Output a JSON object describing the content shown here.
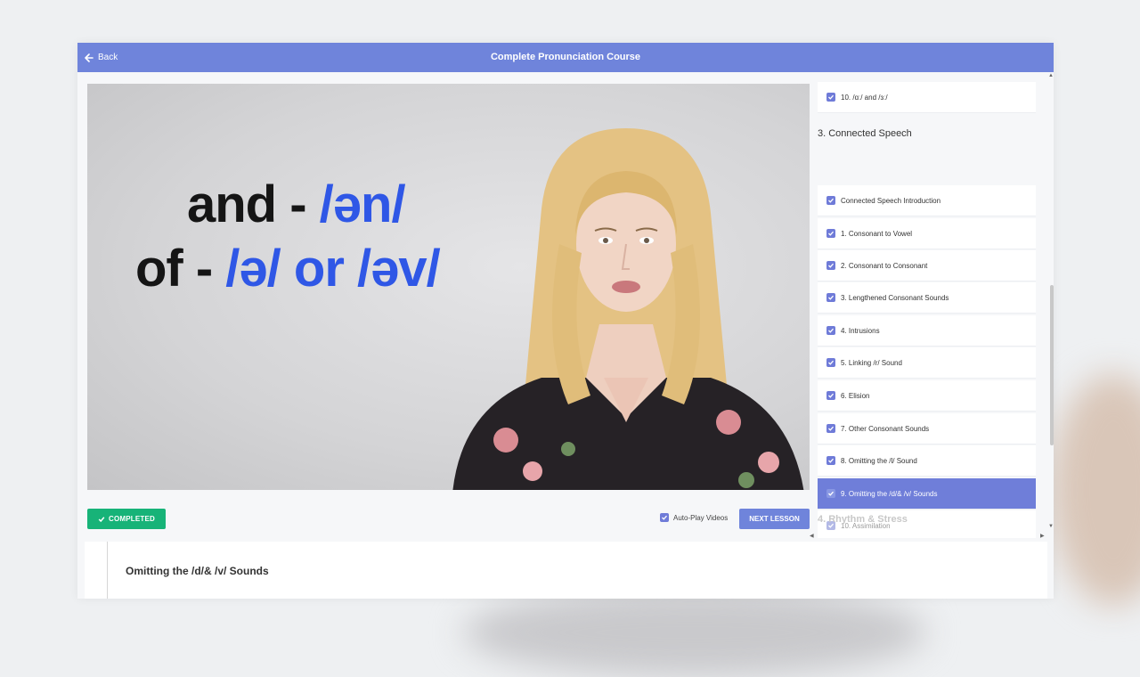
{
  "header": {
    "back_label": "Back",
    "course_title": "Complete Pronunciation Course"
  },
  "video": {
    "caption_lines": [
      {
        "word": "and - ",
        "phonetic": "/ən/"
      },
      {
        "word": "of - ",
        "phonetic": "/ə/ or /əv/"
      }
    ]
  },
  "sections": [
    {
      "title": "3. Connected Speech"
    },
    {
      "title": "4. Rhythm & Stress"
    }
  ],
  "lessons": [
    {
      "label": "10. /ɑː/ and /ɜː/",
      "state": "done"
    },
    {
      "label": "Connected Speech Introduction",
      "state": "done"
    },
    {
      "label": "1. Consonant to Vowel",
      "state": "done"
    },
    {
      "label": "2. Consonant to Consonant",
      "state": "done"
    },
    {
      "label": "3. Lengthened Consonant Sounds",
      "state": "done"
    },
    {
      "label": "4. Intrusions",
      "state": "done"
    },
    {
      "label": "5. Linking /r/ Sound",
      "state": "done"
    },
    {
      "label": "6. Elision",
      "state": "done"
    },
    {
      "label": "7. Other Consonant Sounds",
      "state": "done"
    },
    {
      "label": "8. Omitting the /l/ Sound",
      "state": "done"
    },
    {
      "label": "9. Omitting the /d/& /v/ Sounds",
      "state": "active"
    },
    {
      "label": "10. Assimilation",
      "state": "upcoming"
    }
  ],
  "controls": {
    "completed_label": "COMPLETED",
    "autoplay_label": "Auto-Play Videos",
    "autoplay_checked": true,
    "next_label": "NEXT LESSON"
  },
  "description": {
    "title": "Omitting the /d/& /v/ Sounds"
  },
  "colors": {
    "header_bg": "#6f84db",
    "accent": "#2f57e6",
    "success": "#17b378",
    "active_lesson": "#6f7ed9"
  },
  "icons": {
    "back": "arrow-left-icon",
    "check": "check-icon"
  }
}
